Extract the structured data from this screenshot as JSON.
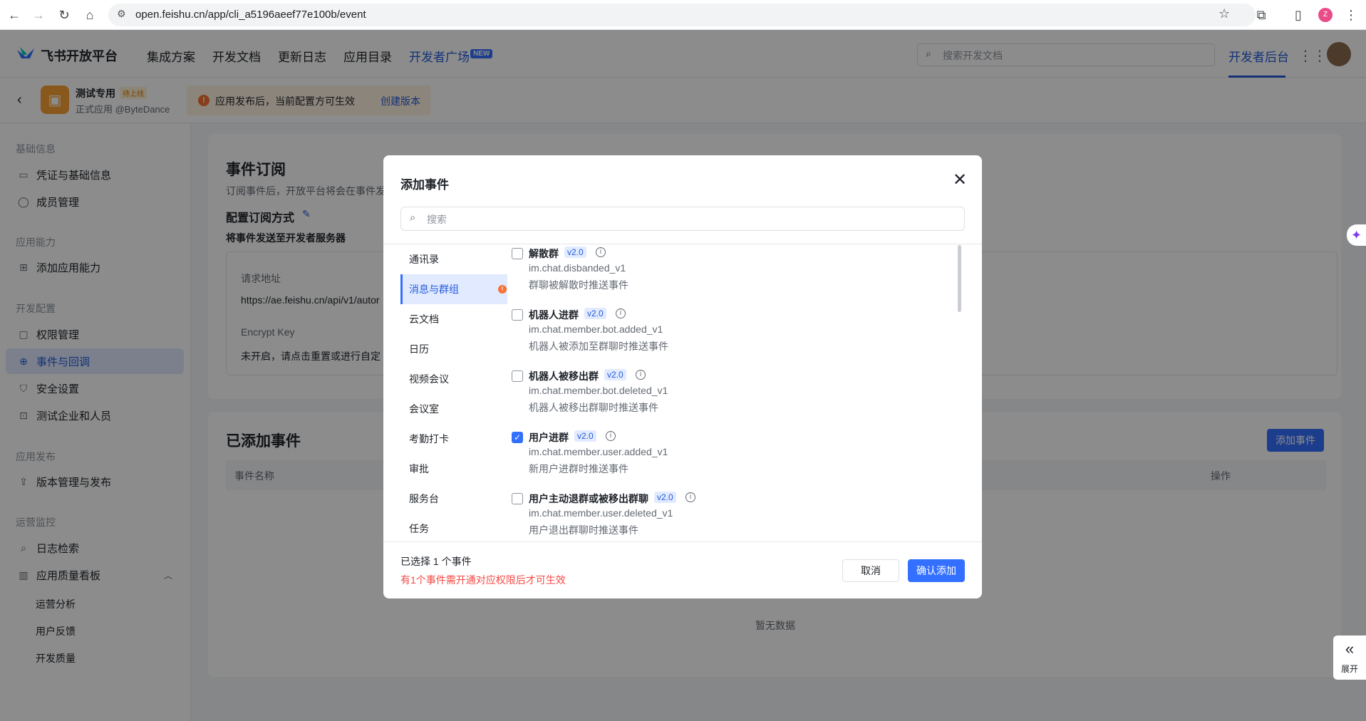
{
  "browser": {
    "url": "open.feishu.cn/app/cli_a5196aeef77e100b/event",
    "profile_initial": "Z"
  },
  "header": {
    "logo": "飞书开放平台",
    "nav": [
      "集成方案",
      "开发文档",
      "更新日志",
      "应用目录",
      "开发者广场"
    ],
    "new_badge": "NEW",
    "search_placeholder": "搜索开发文档",
    "dev_console": "开发者后台"
  },
  "app": {
    "name": "测试专用",
    "status": "待上线",
    "subtitle": "正式应用 @ByteDance",
    "notice": "应用发布后，当前配置方可生效",
    "notice_link": "创建版本"
  },
  "sidebar": {
    "groups": {
      "basic": "基础信息",
      "capability": "应用能力",
      "dev_config": "开发配置",
      "publish": "应用发布",
      "ops": "运营监控"
    },
    "items": {
      "credentials": "凭证与基础信息",
      "members": "成员管理",
      "add_capability": "添加应用能力",
      "permissions": "权限管理",
      "events": "事件与回调",
      "security": "安全设置",
      "test_org": "测试企业和人员",
      "versions": "版本管理与发布",
      "logs": "日志检索",
      "quality": "应用质量看板",
      "ops_analysis": "运营分析",
      "feedback": "用户反馈",
      "dev_quality": "开发质量"
    }
  },
  "main": {
    "sub_title": "事件订阅",
    "sub_desc": "订阅事件后，开放平台将会在事件发",
    "config_mode": "配置订阅方式",
    "send_to": "将事件发送至开发者服务器",
    "request_url_label": "请求地址",
    "request_url": "https://ae.feishu.cn/api/v1/autor",
    "encrypt_label": "Encrypt Key",
    "encrypt_value": "未开启，请点击重置或进行自定",
    "added_title": "已添加事件",
    "add_event_btn": "添加事件",
    "col_name": "事件名称",
    "col_action": "操作",
    "empty": "暂无数据"
  },
  "modal": {
    "title": "添加事件",
    "search_placeholder": "搜索",
    "categories": [
      "通讯录",
      "消息与群组",
      "云文档",
      "日历",
      "视频会议",
      "会议室",
      "考勤打卡",
      "审批",
      "服务台",
      "任务"
    ],
    "active_category": "消息与群组",
    "events": [
      {
        "name": "解散群",
        "version": "v2.0",
        "code": "im.chat.disbanded_v1",
        "desc": "群聊被解散时推送事件",
        "checked": false
      },
      {
        "name": "机器人进群",
        "version": "v2.0",
        "code": "im.chat.member.bot.added_v1",
        "desc": "机器人被添加至群聊时推送事件",
        "checked": false
      },
      {
        "name": "机器人被移出群",
        "version": "v2.0",
        "code": "im.chat.member.bot.deleted_v1",
        "desc": "机器人被移出群聊时推送事件",
        "checked": false
      },
      {
        "name": "用户进群",
        "version": "v2.0",
        "code": "im.chat.member.user.added_v1",
        "desc": "新用户进群时推送事件",
        "checked": true
      },
      {
        "name": "用户主动退群或被移出群聊",
        "version": "v2.0",
        "code": "im.chat.member.user.deleted_v1",
        "desc": "用户退出群聊时推送事件",
        "checked": false
      }
    ],
    "selected_count": "已选择 1 个事件",
    "warning": "有1个事件需开通对应权限后才可生效",
    "cancel": "取消",
    "confirm": "确认添加"
  },
  "float": {
    "expand": "展开"
  },
  "colors": {
    "accent": "#3370ff",
    "brand_link": "#245bdb",
    "warning": "#f54a45"
  }
}
